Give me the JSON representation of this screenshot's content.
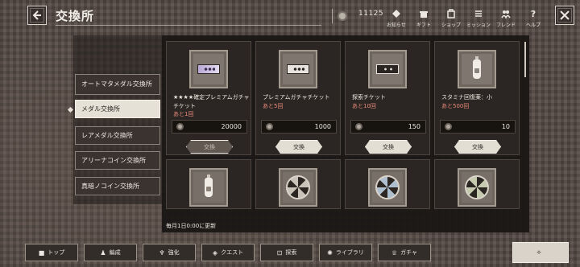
{
  "header": {
    "title": "交換所",
    "currency_value": "11125",
    "buttons": [
      {
        "name": "news",
        "label": "お知らせ",
        "icon": "news-icon"
      },
      {
        "name": "gift",
        "label": "ギフト",
        "icon": "gift-icon"
      },
      {
        "name": "shop",
        "label": "ショップ",
        "icon": "shop-icon"
      },
      {
        "name": "mission",
        "label": "ミッション",
        "icon": "mission-icon"
      },
      {
        "name": "friend",
        "label": "フレンド",
        "icon": "friend-icon"
      },
      {
        "name": "help",
        "label": "ヘルプ",
        "icon": "help-icon"
      }
    ]
  },
  "categories": [
    {
      "label": "オートマタメダル交換所",
      "active": false
    },
    {
      "label": "メダル交換所",
      "active": true
    },
    {
      "label": "レアメダル交換所",
      "active": false
    },
    {
      "label": "アリーナコイン交換所",
      "active": false
    },
    {
      "label": "真暗ノコイン交換所",
      "active": false
    }
  ],
  "items": [
    {
      "name": "★★★★確定プレミアムガチャチケット",
      "remaining": "あと1回",
      "price": "20000",
      "button": "交換",
      "disabled": true,
      "icon": "premium-ticket-icon"
    },
    {
      "name": "プレミアムガチャチケット",
      "remaining": "あと5回",
      "price": "1000",
      "button": "交換",
      "disabled": false,
      "icon": "gacha-ticket-icon"
    },
    {
      "name": "探索チケット",
      "remaining": "あと10回",
      "price": "150",
      "button": "交換",
      "disabled": false,
      "icon": "explore-ticket-icon"
    },
    {
      "name": "スタミナ回復薬：小",
      "remaining": "あと500回",
      "price": "10",
      "button": "交換",
      "disabled": false,
      "icon": "stamina-vial-icon"
    }
  ],
  "items_row2_icons": [
    "vial-icon",
    "rune-icon",
    "rune-icon",
    "rune-icon"
  ],
  "footer_note": "毎月1日0:00に更新",
  "nav": [
    {
      "label": "トップ",
      "icon": "home-icon"
    },
    {
      "label": "編成",
      "icon": "party-icon"
    },
    {
      "label": "強化",
      "icon": "enhance-icon"
    },
    {
      "label": "クエスト",
      "icon": "quest-icon"
    },
    {
      "label": "探索",
      "icon": "explore-icon"
    },
    {
      "label": "ライブラリ",
      "icon": "library-icon"
    },
    {
      "label": "ガチャ",
      "icon": "gacha-icon"
    },
    {
      "label": "",
      "icon": "active-tab-icon"
    }
  ]
}
